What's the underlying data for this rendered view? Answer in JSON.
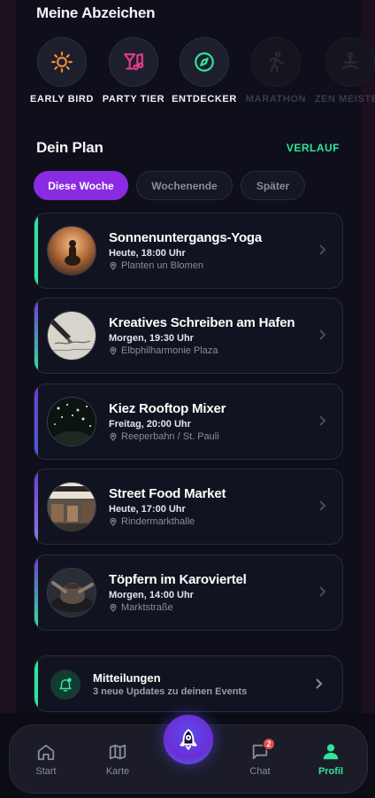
{
  "badges": {
    "title": "Meine Abzeichen",
    "items": [
      {
        "label": "EARLY BIRD",
        "icon": "sun-icon",
        "color": "#f08a3c",
        "locked": false
      },
      {
        "label": "PARTY TIER",
        "icon": "music-icon",
        "color": "#e23c8a",
        "locked": false
      },
      {
        "label": "ENTDECKER",
        "icon": "compass-icon",
        "color": "#2ee59a",
        "locked": false
      },
      {
        "label": "MARATHON",
        "icon": "runner-icon",
        "color": "#2a2b38",
        "locked": true
      },
      {
        "label": "ZEN MEISTER",
        "icon": "meditation-icon",
        "color": "#2a2b38",
        "locked": true
      }
    ]
  },
  "plan": {
    "title": "Dein Plan",
    "history_link": "VERLAUF",
    "filters": [
      {
        "label": "Diese Woche",
        "active": true
      },
      {
        "label": "Wochenende",
        "active": false
      },
      {
        "label": "Später",
        "active": false
      }
    ],
    "events": [
      {
        "title": "Sonnenuntergangs-Yoga",
        "time": "Heute, 18:00 Uhr",
        "location": "Planten un Blomen",
        "accent": "#2ee59a",
        "image": "yoga-image"
      },
      {
        "title": "Kreatives Schreiben am Hafen",
        "time": "Morgen, 19:30 Uhr",
        "location": "Elbphilharmonie Plaza",
        "accent": "#6a3cd8",
        "image": "writing-image"
      },
      {
        "title": "Kiez Rooftop Mixer",
        "time": "Freitag, 20:00 Uhr",
        "location": "Reeperbahn / St. Pauli",
        "accent": "#6a3cd8",
        "image": "party-image"
      },
      {
        "title": "Street Food Market",
        "time": "Heute, 17:00 Uhr",
        "location": "Rindermarkthalle",
        "accent": "#6a3cd8",
        "image": "market-image"
      },
      {
        "title": "Töpfern im Karoviertel",
        "time": "Morgen, 14:00 Uhr",
        "location": "Marktstraße",
        "accent": "#6a3cd8",
        "image": "pottery-image"
      }
    ]
  },
  "notifications": {
    "title": "Mitteilungen",
    "subtitle": "3 neue Updates zu deinen Events",
    "icon": "bell-icon"
  },
  "tabbar": {
    "items": [
      {
        "label": "Start",
        "icon": "home-icon",
        "active": false
      },
      {
        "label": "Karte",
        "icon": "map-icon",
        "active": false
      },
      {
        "label": "Chat",
        "icon": "chat-icon",
        "active": false,
        "badge": "2"
      },
      {
        "label": "Profil",
        "icon": "profile-icon",
        "active": true
      }
    ],
    "center_icon": "rocket-icon"
  },
  "colors": {
    "accent_green": "#2ee59a",
    "accent_purple": "#8a2be2",
    "background": "#0e0f1a"
  }
}
